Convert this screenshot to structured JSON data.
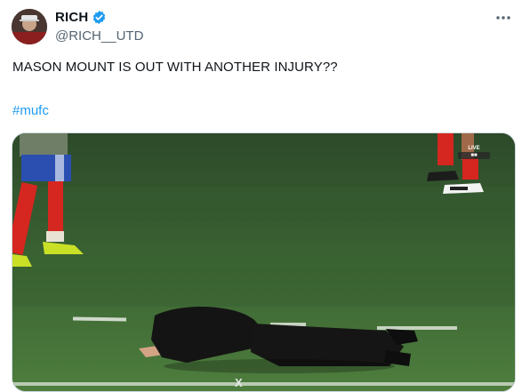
{
  "author": {
    "display_name": "RICH",
    "handle": "@RICH__UTD",
    "verified": true
  },
  "icons": {
    "verified": "verified-badge-icon",
    "more": "more-options-icon"
  },
  "tweet": {
    "text": "MASON MOUNT IS OUT WITH ANOTHER INJURY??",
    "hashtag": "#mufc"
  },
  "media": {
    "badge_top": "LIVE",
    "watermark": "X"
  },
  "colors": {
    "hashtag": "#1d9bf0",
    "verified": "#1d9bf0",
    "pitch": "#3b6b33"
  }
}
